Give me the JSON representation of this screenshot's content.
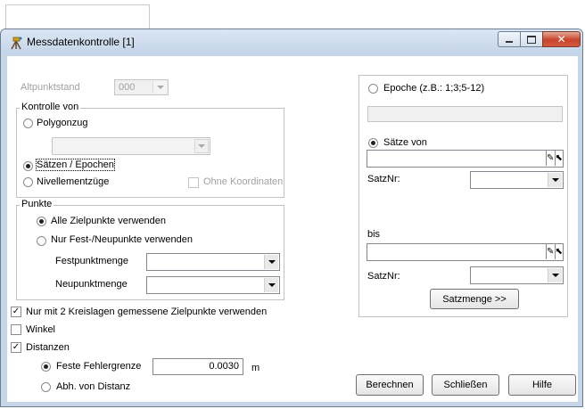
{
  "window": {
    "title": "Messdatenkontrolle [1]"
  },
  "left": {
    "altpunktstand": {
      "label": "Altpunktstand",
      "value": "000"
    },
    "kontrolle": {
      "legend": "Kontrolle von",
      "polygonzug": "Polygonzug",
      "saetze_epochen": "Sätzen / Epochen",
      "nivellement": "Nivellementzüge",
      "ohne_koordinaten": "Ohne Koordinaten"
    },
    "punkte": {
      "legend": "Punkte",
      "alle": "Alle Zielpunkte verwenden",
      "nur_fest": "Nur Fest-/Neupunkte verwenden",
      "festpunktmenge": "Festpunktmenge",
      "neupunktmenge": "Neupunktmenge"
    },
    "kreislagen": "Nur mit 2 Kreislagen gemessene Zielpunkte verwenden",
    "winkel": "Winkel",
    "distanzen": "Distanzen",
    "feste_fehlergrenze": {
      "label": "Feste Fehlergrenze",
      "value": "0.0030",
      "unit": "m"
    },
    "abh_distanz": "Abh. von Distanz"
  },
  "right": {
    "epoche": "Epoche (z.B.: 1;3;5-12)",
    "saetze_von": "Sätze von",
    "satznr_label": "SatzNr:",
    "bis": "bis",
    "satzmenge_button": "Satzmenge >>"
  },
  "buttons": {
    "berechnen": "Berechnen",
    "schliessen": "Schließen",
    "hilfe": "Hilfe"
  },
  "icons": {
    "app": "survey-tripod-icon",
    "minimize": "minimize-icon",
    "maximize": "maximize-icon",
    "close": "close-icon",
    "picker": "point-picker-icon"
  }
}
